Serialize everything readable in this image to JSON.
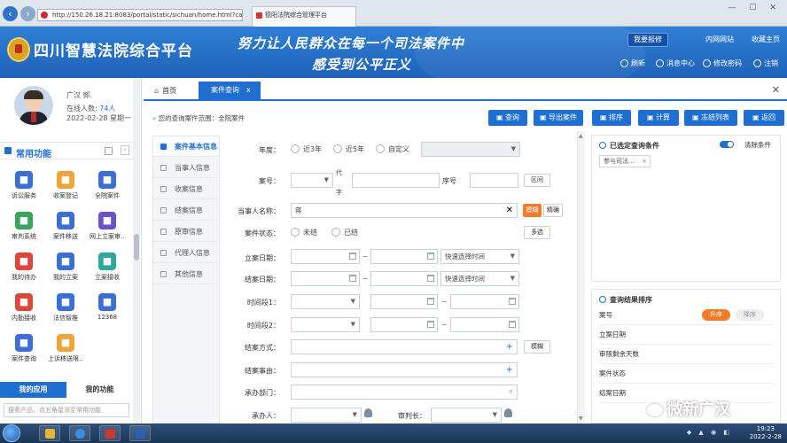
{
  "browser": {
    "url": "http://150.26.18.21:8083/portal/static/sichuan/home.html?cake",
    "tab_title": "德阳法院综合管理平台",
    "window_controls": "— ☐ ✕"
  },
  "header": {
    "title": "四川智慧法院综合平台",
    "slogan_line1": "努力让人民群众在每一个司法案件中",
    "slogan_line2": "感受到公平正义",
    "links": [
      "我要报修",
      "内网网站",
      "收藏主页"
    ],
    "actions": [
      "刷新",
      "消息中心",
      "修改密码",
      "注销"
    ]
  },
  "user": {
    "name": "广汉 郭.",
    "online_label": "在线人数: ",
    "online_count": "74人",
    "date": "2022-02-28 星期一"
  },
  "sidebar": {
    "common_title": "常用功能",
    "functions": [
      {
        "label": "诉讼服务",
        "icon": "service-icon",
        "color": "#3b6fd8"
      },
      {
        "label": "收案登记",
        "icon": "register-icon",
        "color": "#f0a53b"
      },
      {
        "label": "全院案件",
        "icon": "cases-icon",
        "color": "#3b6fd8"
      },
      {
        "label": "审判系统",
        "icon": "gavel-icon",
        "color": "#3aa65c"
      },
      {
        "label": "案件移送",
        "icon": "transfer-icon",
        "color": "#3b6fd8"
      },
      {
        "label": "网上立案审...",
        "icon": "online-file-icon",
        "color": "#6b52c9"
      },
      {
        "label": "我的待办",
        "icon": "todo-icon",
        "color": "#e0453a"
      },
      {
        "label": "我的立案",
        "icon": "my-file-icon",
        "color": "#3b6fd8"
      },
      {
        "label": "立案接收",
        "icon": "receive-icon",
        "color": "#2fa89a"
      },
      {
        "label": "内勤接收",
        "icon": "inbox-icon",
        "color": "#e0453a"
      },
      {
        "label": "法信智推",
        "icon": "shield-icon",
        "color": "#3b6fd8"
      },
      {
        "label": "12368",
        "icon": "phone-icon",
        "color": "#3b6fd8"
      },
      {
        "label": "案件查询",
        "icon": "query-icon",
        "color": "#3b6fd8"
      },
      {
        "label": "上诉移送限...",
        "icon": "appeal-icon",
        "color": "#f0a53b"
      }
    ],
    "tabs": [
      "我的应用",
      "我的功能"
    ],
    "search_placeholder": "搜索产品，点五角星添至常用功能"
  },
  "tabs": [
    "首页",
    "案件查询"
  ],
  "query": {
    "scope": "您的查询案件范围：全院案件"
  },
  "toolbar": [
    {
      "label": "查询",
      "icon": "search-icon"
    },
    {
      "label": "导出案件",
      "icon": "export-icon"
    },
    {
      "label": "排序",
      "icon": "sort-icon"
    },
    {
      "label": "计算",
      "icon": "chart-icon"
    },
    {
      "label": "冻结列表",
      "icon": "lock-icon"
    },
    {
      "label": "返回",
      "icon": "back-icon"
    }
  ],
  "case_nav": [
    {
      "label": "案件基本信息",
      "active": true
    },
    {
      "label": "当事人信息",
      "active": false
    },
    {
      "label": "收案信息",
      "active": false
    },
    {
      "label": "结案信息",
      "active": false
    },
    {
      "label": "原审信息",
      "active": false
    },
    {
      "label": "代理人信息",
      "active": false
    },
    {
      "label": "其他信息",
      "active": false
    }
  ],
  "form": {
    "year": {
      "label": "年度：",
      "options": [
        "近3年",
        "近5年",
        "自定义"
      ]
    },
    "case_no": {
      "label": "案号：",
      "middle_label": [
        "代",
        "字"
      ],
      "seq_label": "序号",
      "range_btn": "区间"
    },
    "party": {
      "label": "当事人名称：",
      "value": "蒋",
      "fuzzy": "模糊",
      "exact": "精确"
    },
    "status": {
      "label": "案件状态：",
      "options": [
        "未结",
        "已结"
      ],
      "multi_btn": "多选"
    },
    "file_date": {
      "label": "立案日期：",
      "quick": "快速选择时间"
    },
    "close_date": {
      "label": "结案日期：",
      "quick": "快速选择时间"
    },
    "period1": {
      "label": "时间段1："
    },
    "period2": {
      "label": "时间段2："
    },
    "close_method": {
      "label": "结案方式：",
      "fuzzy": "模糊"
    },
    "close_reason": {
      "label": "结案事由："
    },
    "dept": {
      "label": "承办部门："
    },
    "handler": {
      "label": "承办人："
    },
    "chief_judge": {
      "label": "审判长："
    }
  },
  "conditions": {
    "title": "已选定查询条件",
    "clear_label": "清除条件",
    "tags": [
      "参与司法..."
    ]
  },
  "sort": {
    "title": "查询结果排序",
    "rows": [
      "案号",
      "立案日期",
      "审限剩余天数",
      "案件状态",
      "结案日期"
    ],
    "asc": "升序",
    "desc": "降序"
  },
  "watermark": {
    "text": "微新广汉"
  },
  "taskbar": {
    "time": "19:23",
    "date": "2022-2-28",
    "tray": "◆ ▲ ◉ ◧"
  }
}
